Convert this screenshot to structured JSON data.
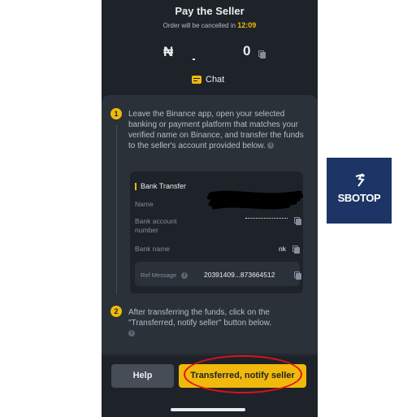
{
  "header": {
    "title": "Pay the Seller",
    "countdown_prefix": "Order will be cancelled in",
    "countdown_time": "12:09"
  },
  "amount": {
    "currency_symbol": "₦",
    "visible_tail": "0"
  },
  "chat": {
    "label": "Chat"
  },
  "step1": {
    "number": "1",
    "text": "Leave the Binance app, open your selected banking or payment platform that matches your verified name on Binance, and transfer the funds to the seller's account provided below."
  },
  "bank": {
    "method": "Bank Transfer",
    "name_label": "Name",
    "account_label": "Bank account number",
    "bank_name_label": "Bank name",
    "bank_name_value": "nk",
    "ref_label": "Ref Message",
    "ref_value": "20391409...873664512"
  },
  "step2": {
    "number": "2",
    "text": "After transferring the funds, click on the \"Transferred, notify seller\" button below."
  },
  "buttons": {
    "help": "Help",
    "notify": "Transferred, notify seller"
  },
  "logo": {
    "text": "SBOTOP"
  },
  "colors": {
    "accent": "#f0b90b",
    "background": "#1e2329",
    "card": "#2b3139",
    "highlight_oval": "#e0101a",
    "logo_bg": "#1c3566"
  }
}
